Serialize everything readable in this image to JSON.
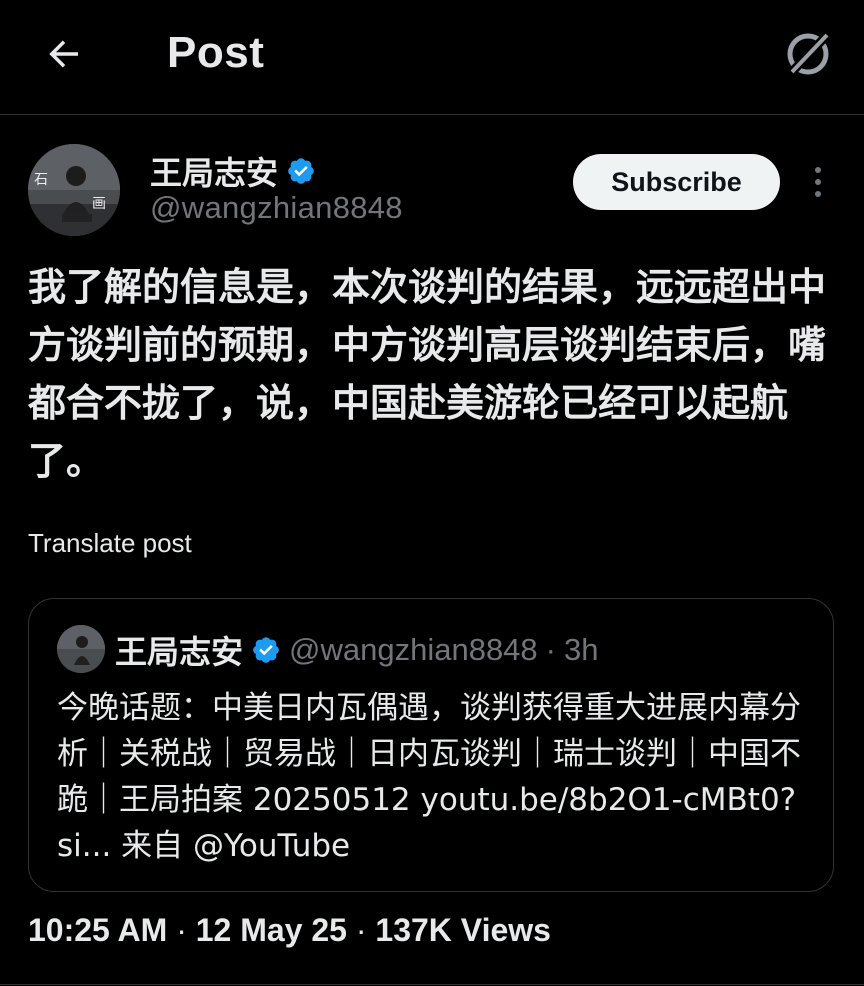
{
  "header": {
    "title": "Post",
    "back_icon": "arrow-left-icon",
    "grok_icon": "grok-icon"
  },
  "post": {
    "author": {
      "name": "王局志安",
      "handle": "@wangzhian8848",
      "verified": true
    },
    "subscribe_label": "Subscribe",
    "text": "我了解的信息是，本次谈判的结果，远远超出中方谈判前的预期，中方谈判高层谈判结束后，嘴都合不拢了，说，中国赴美游轮已经可以起航了。",
    "translate_label": "Translate post",
    "timestamp": "10:25 AM",
    "date": "12 May 25",
    "views": "137K",
    "views_label": "Views"
  },
  "quote": {
    "author_name": "王局志安",
    "handle": "@wangzhian8848",
    "time": "3h",
    "text": "今晚话题：中美日内瓦偶遇，谈判获得重大进展内幕分析｜关税战｜贸易战｜日内瓦谈判｜瑞士谈判｜中国不跪｜王局拍案 20250512 youtu.be/8b2O1-cMBt0?si... 来自 @YouTube"
  },
  "colors": {
    "background": "#000000",
    "text_primary": "#e7e9ea",
    "text_secondary": "#71767b",
    "verified_blue": "#1d9bf0",
    "border": "#2f3336"
  }
}
